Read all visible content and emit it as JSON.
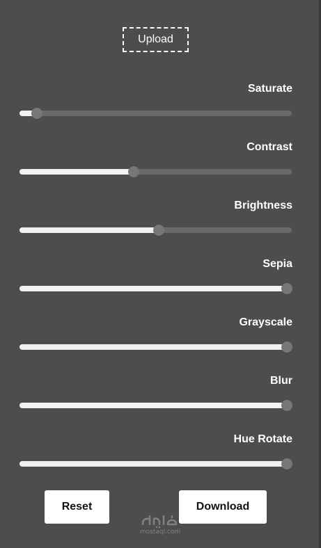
{
  "upload": {
    "label": "Upload"
  },
  "filters": [
    {
      "key": "saturate",
      "label": "Saturate",
      "value": 0.03
    },
    {
      "key": "contrast",
      "label": "Contrast",
      "value": 0.405
    },
    {
      "key": "brightness",
      "label": "Brightness",
      "value": 0.503
    },
    {
      "key": "sepia",
      "label": "Sepia",
      "value": 1.0
    },
    {
      "key": "grayscale",
      "label": "Grayscale",
      "value": 1.0
    },
    {
      "key": "blur",
      "label": "Blur",
      "value": 1.0
    },
    {
      "key": "hue-rotate",
      "label": "Hue Rotate",
      "value": 1.0
    }
  ],
  "buttons": {
    "reset_label": "Reset",
    "download_label": "Download"
  },
  "watermark": {
    "domain": "mostaql.com"
  },
  "colors": {
    "background": "#4d4d4d",
    "track": "#6a6a6a",
    "fill": "#f2f2f2",
    "thumb": "#777777",
    "button": "#ffffff"
  }
}
